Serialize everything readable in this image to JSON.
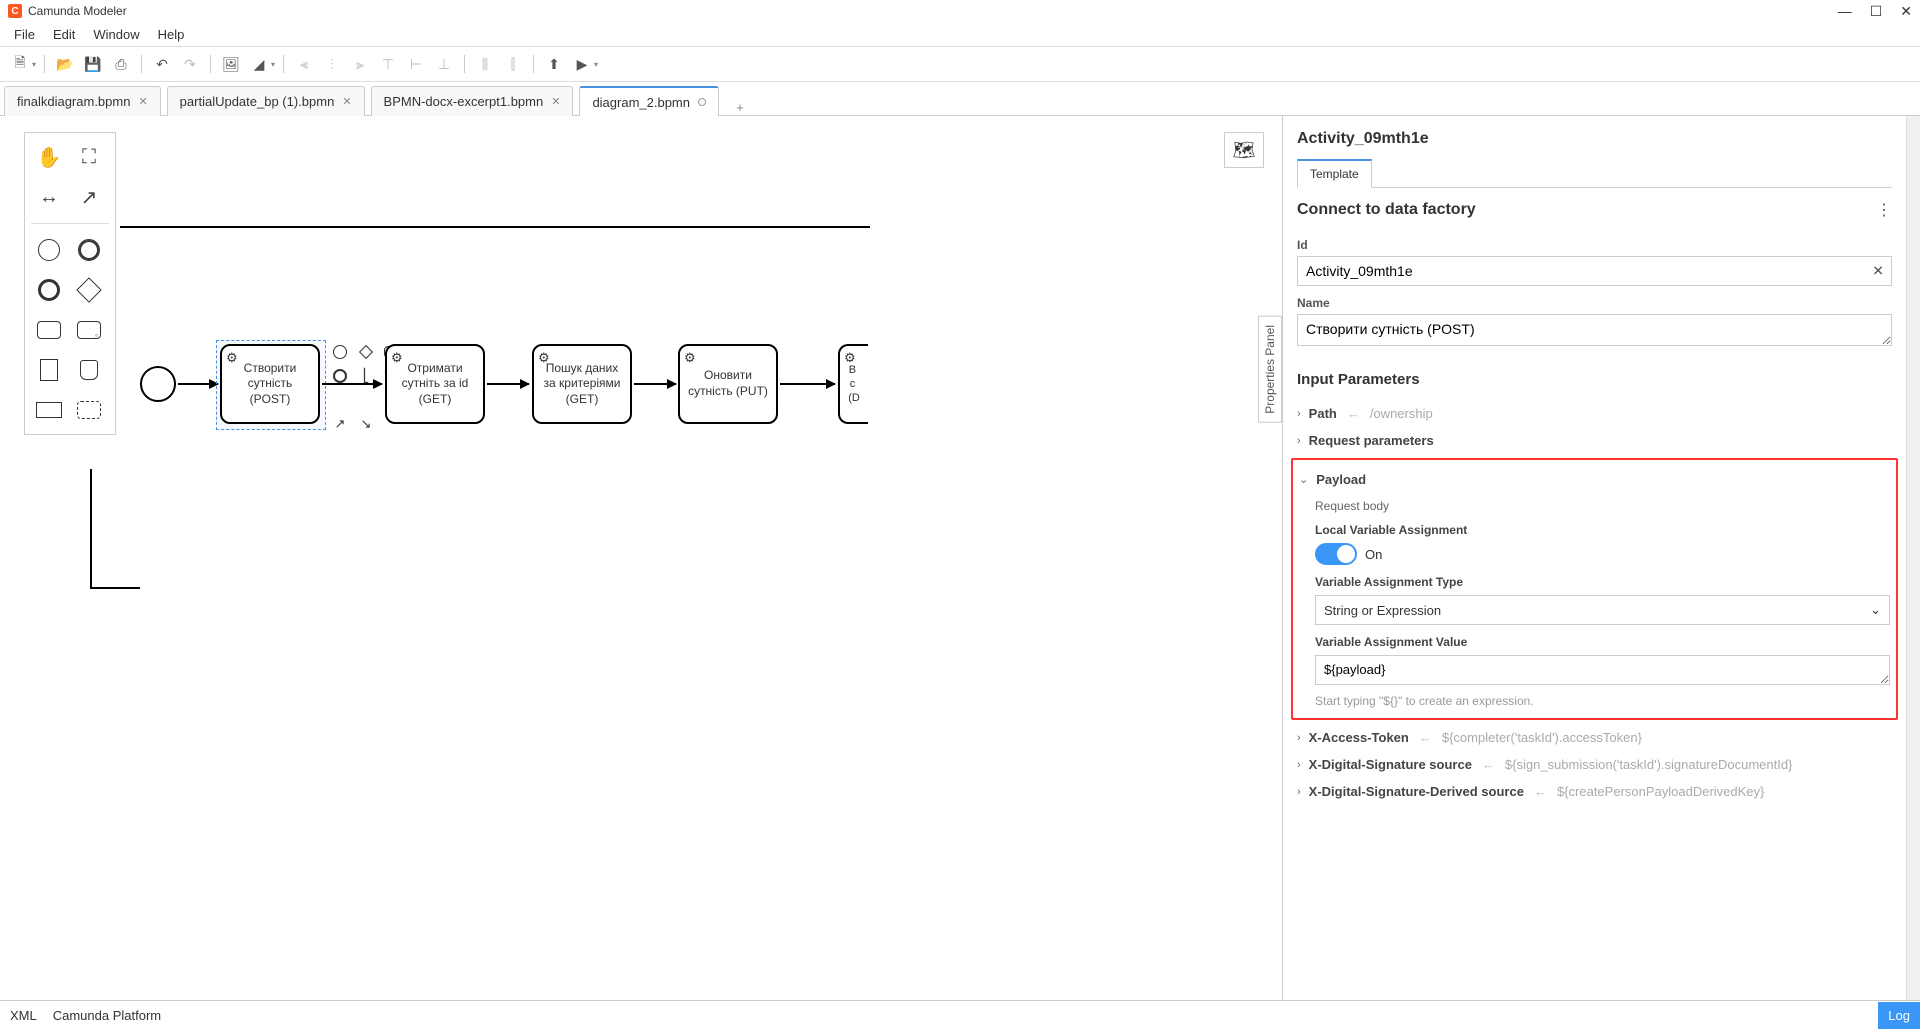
{
  "titlebar": {
    "title": "Camunda Modeler"
  },
  "menubar": {
    "file": "File",
    "edit": "Edit",
    "window": "Window",
    "help": "Help"
  },
  "tabs": {
    "items": [
      {
        "label": "finalkdiagram.bpmn"
      },
      {
        "label": "partialUpdate_bp (1).bpmn"
      },
      {
        "label": "BPMN-docx-excerpt1.bpmn"
      },
      {
        "label": "diagram_2.bpmn"
      }
    ]
  },
  "diagram": {
    "task1": "Створити сутність (POST)",
    "task2": "Отримати сутніть за id (GET)",
    "task3": "Пошук даних за критеріями (GET)",
    "task4": "Оновити сутність (PUT)",
    "task5": "В  с  (D"
  },
  "panel": {
    "title": "Activity_09mth1e",
    "tab": "Template",
    "section": "Connect to data factory",
    "id_label": "Id",
    "id_value": "Activity_09mth1e",
    "name_label": "Name",
    "name_value": "Створити сутність (POST)",
    "input_params": "Input Parameters",
    "path_label": "Path",
    "path_hint": "/ownership",
    "req_params": "Request parameters",
    "payload_label": "Payload",
    "req_body": "Request body",
    "local_var": "Local Variable Assignment",
    "toggle_on": "On",
    "var_type_label": "Variable Assignment Type",
    "var_type_value": "String or Expression",
    "var_value_label": "Variable Assignment Value",
    "var_value": "${payload}",
    "help": "Start typing \"${}\" to create an expression.",
    "xaccess": "X-Access-Token",
    "xaccess_hint": "${completer('taskId').accessToken}",
    "xsig": "X-Digital-Signature source",
    "xsig_hint": "${sign_submission('taskId').signatureDocumentId}",
    "xsigd": "X-Digital-Signature-Derived source",
    "xsigd_hint": "${createPersonPayloadDerivedKey}"
  },
  "statusbar": {
    "xml": "XML",
    "platform": "Camunda Platform",
    "log": "Log"
  },
  "proplabel": "Properties Panel"
}
